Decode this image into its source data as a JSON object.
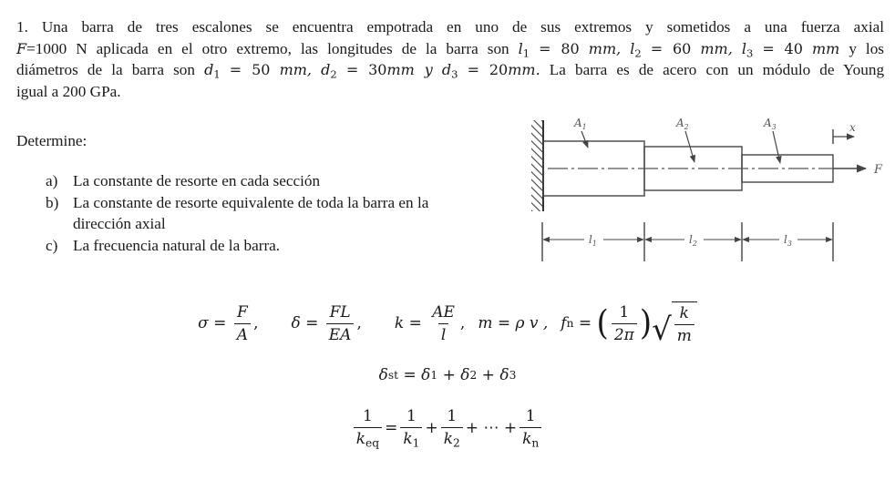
{
  "problem": {
    "number": "1.",
    "line1": "Una barra de tres escalones se encuentra empotrada en uno de sus extremos y sometidos a una fuerza axial",
    "force_symbol": "F",
    "line2_a": "=1000 N aplicada en el otro extremo, las longitudes de la barra son",
    "l1_sym": "l",
    "l1_sub": "1",
    "l1_val": "= 80",
    "l1_unit": "mm,",
    "l2_sym": "l",
    "l2_sub": "2",
    "l2_val": "= 60",
    "l2_unit": "mm,",
    "l3_sym": "l",
    "l3_sub": "3",
    "l3_val": "= 40",
    "l3_unit": "mm",
    "line2_end": "y los",
    "line3_a": "diámetros de la barra son",
    "d1_sym": "d",
    "d1_sub": "1",
    "d1_val": "= 50",
    "d1_unit": "mm,",
    "d2_sym": "d",
    "d2_sub": "2",
    "d2_val": "= 30",
    "d2_unit": "mm y",
    "d3_sym": "d",
    "d3_sub": "3",
    "d3_val": "= 20",
    "d3_unit": "mm.",
    "line3_end": "La barra es de acero con un módulo de Young",
    "line4": "igual a 200 GPa."
  },
  "determine": {
    "heading": "Determine:",
    "items": [
      {
        "label": "a)",
        "text": "La constante de resorte en cada sección"
      },
      {
        "label": "b)",
        "text": "La constante de resorte equivalente de toda la barra en la",
        "text2": "dirección axial"
      },
      {
        "label": "c)",
        "text": "La frecuencia natural de la barra."
      }
    ]
  },
  "diagram": {
    "area_labels": [
      "A",
      "A",
      "A"
    ],
    "area_subs": [
      "1",
      "2",
      "3"
    ],
    "length_labels": [
      "l",
      "l",
      "l"
    ],
    "length_subs": [
      "1",
      "2",
      "3"
    ],
    "force_label": "F",
    "axis_label": "x"
  },
  "formulas": {
    "sigma": {
      "lhs": "σ =",
      "num": "F",
      "den": "A",
      "tail": ","
    },
    "delta": {
      "lhs": "δ =",
      "num": "FL",
      "den": "EA",
      "tail": ","
    },
    "k": {
      "lhs": "k =",
      "num": "AE",
      "den": "l",
      "tail": ","
    },
    "m": {
      "text": "m = ρ v ,"
    },
    "fn": {
      "lhs": "f",
      "lhs_sub": "n",
      "eq": "=",
      "num": "1",
      "den": "2π",
      "rad_num": "k",
      "rad_den": "m"
    },
    "delta_st": {
      "lhs": "δ",
      "lhs_sub": "st",
      "rhs": "= δ",
      "s1": "1",
      "p1": "+ δ",
      "s2": "2",
      "p2": "+ δ",
      "s3": "3"
    },
    "keq": {
      "lhs_num": "1",
      "lhs_den": "k",
      "lhs_den_sub": "eq",
      "terms": [
        {
          "num": "1",
          "den": "k",
          "sub": "1"
        },
        {
          "num": "1",
          "den": "k",
          "sub": "2"
        },
        {
          "num": "1",
          "den": "k",
          "sub": "n"
        }
      ],
      "plus": "+",
      "ellipsis": "+ ⋯ +",
      "eq": "="
    }
  }
}
